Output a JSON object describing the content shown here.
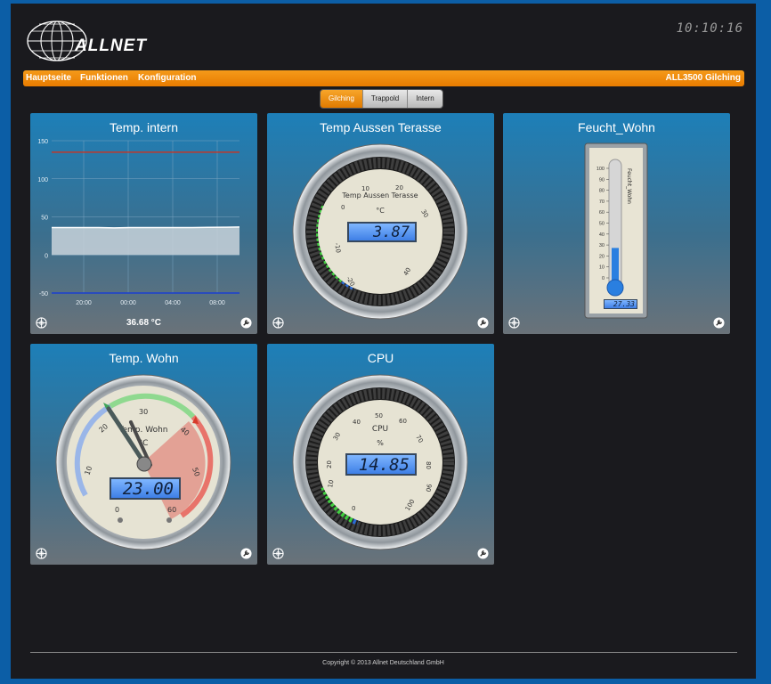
{
  "header": {
    "brand": "ALLNET",
    "clock": "10:10:16"
  },
  "nav": {
    "items": [
      "Hauptseite",
      "Funktionen",
      "Konfiguration"
    ],
    "device": "ALL3500 Gilching"
  },
  "tabs": [
    "Gilching",
    "Trappold",
    "Intern"
  ],
  "widgets": {
    "temp_intern": {
      "title": "Temp. intern",
      "value": "36.68 °C",
      "chart_data": {
        "type": "area",
        "x_ticks": [
          "20:00",
          "00:00",
          "04:00",
          "08:00"
        ],
        "y_ticks": [
          150,
          100,
          50,
          0,
          -50
        ],
        "ylim": [
          -50,
          150
        ],
        "max_line": 135,
        "min_line": -50,
        "values": [
          36,
          36,
          36,
          36,
          35.5,
          36,
          36,
          36,
          36,
          36,
          36.3,
          36.4,
          36.68
        ],
        "colors": {
          "max_line": "#c0392b",
          "min_line": "#1a3fd1",
          "area": "#c9d3da",
          "line": "#ffffff"
        }
      }
    },
    "temp_aussen": {
      "title": "Temp Aussen Terasse",
      "gauge_label": "Temp Aussen Terasse",
      "unit": "°C",
      "lcd": "3.87",
      "ticks": [
        "-20",
        "-10",
        "0",
        "10",
        "20",
        "30",
        "40"
      ]
    },
    "feucht_wohn": {
      "title": "Feucht_Wohn",
      "scale_label": "Feucht_Wohn",
      "lcd": "27.33",
      "ticks": [
        "100",
        "90",
        "80",
        "70",
        "60",
        "50",
        "40",
        "30",
        "20",
        "10",
        "0"
      ],
      "level": 27.33
    },
    "temp_wohn": {
      "title": "Temp. Wohn",
      "gauge_label": "Temp. Wohn",
      "unit": "°C",
      "lcd": "23.00",
      "ticks": [
        "0",
        "10",
        "20",
        "30",
        "40",
        "50",
        "60"
      ]
    },
    "cpu": {
      "title": "CPU",
      "gauge_label": "CPU",
      "unit": "%",
      "lcd": "14.85",
      "ticks": [
        "0",
        "10",
        "20",
        "30",
        "40",
        "50",
        "60",
        "70",
        "80",
        "90",
        "100"
      ]
    }
  },
  "footer": {
    "copyright": "Copyright © 2013 Allnet Deutschland GmbH"
  }
}
